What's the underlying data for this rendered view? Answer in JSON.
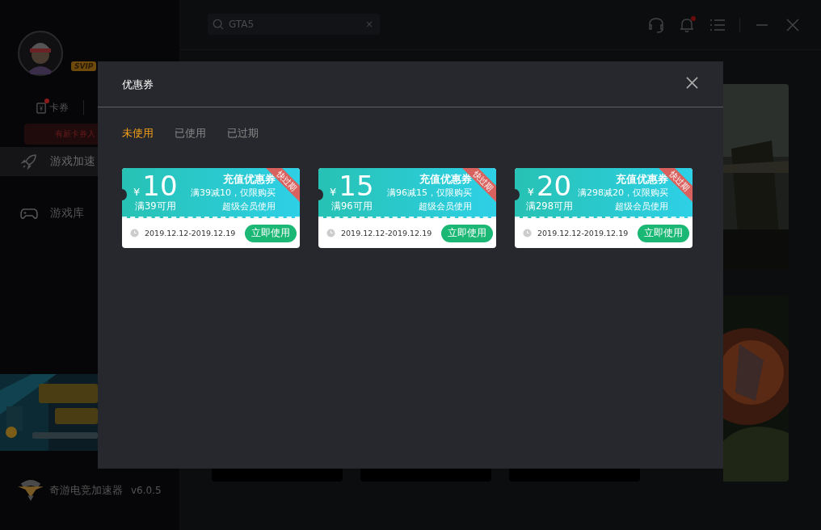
{
  "sidebar": {
    "badge": "SVIP",
    "card_button": {
      "label": "卡券",
      "has_new": true
    },
    "tooltip": "有新卡券入",
    "nav": [
      {
        "label": "游戏加速",
        "kind": "rocket",
        "selected": true
      },
      {
        "label": "游戏库",
        "kind": "gamepad",
        "selected": false
      }
    ],
    "brand": {
      "name": "奇游电竞加速器",
      "version": "v6.0.5"
    }
  },
  "search": {
    "value": "GTA5",
    "clear": "×"
  },
  "notifications": {
    "unread": true
  },
  "dialog": {
    "title": "优惠券",
    "tabs": [
      {
        "label": "未使用",
        "selected": true
      },
      {
        "label": "已使用",
        "selected": false
      },
      {
        "label": "已过期",
        "selected": false
      }
    ],
    "coupons": [
      {
        "currency": "¥",
        "amount": "10",
        "condition": "满39可用",
        "title": "充值优惠券",
        "desc_line1": "满39减10，仅限购买",
        "desc_line2": "超级会员使用",
        "ribbon": "快过期",
        "dates": "2019.12.12-2019.12.19",
        "action": "立即使用"
      },
      {
        "currency": "¥",
        "amount": "15",
        "condition": "满96可用",
        "title": "充值优惠券",
        "desc_line1": "满96减15，仅限购买",
        "desc_line2": "超级会员使用",
        "ribbon": "快过期",
        "dates": "2019.12.12-2019.12.19",
        "action": "立即使用"
      },
      {
        "currency": "¥",
        "amount": "20",
        "condition": "满298可用",
        "title": "充值优惠券",
        "desc_line1": "满298减20，仅限购买",
        "desc_line2": "超级会员使用",
        "ribbon": "快过期",
        "dates": "2019.12.12-2019.12.19",
        "action": "立即使用"
      }
    ]
  }
}
